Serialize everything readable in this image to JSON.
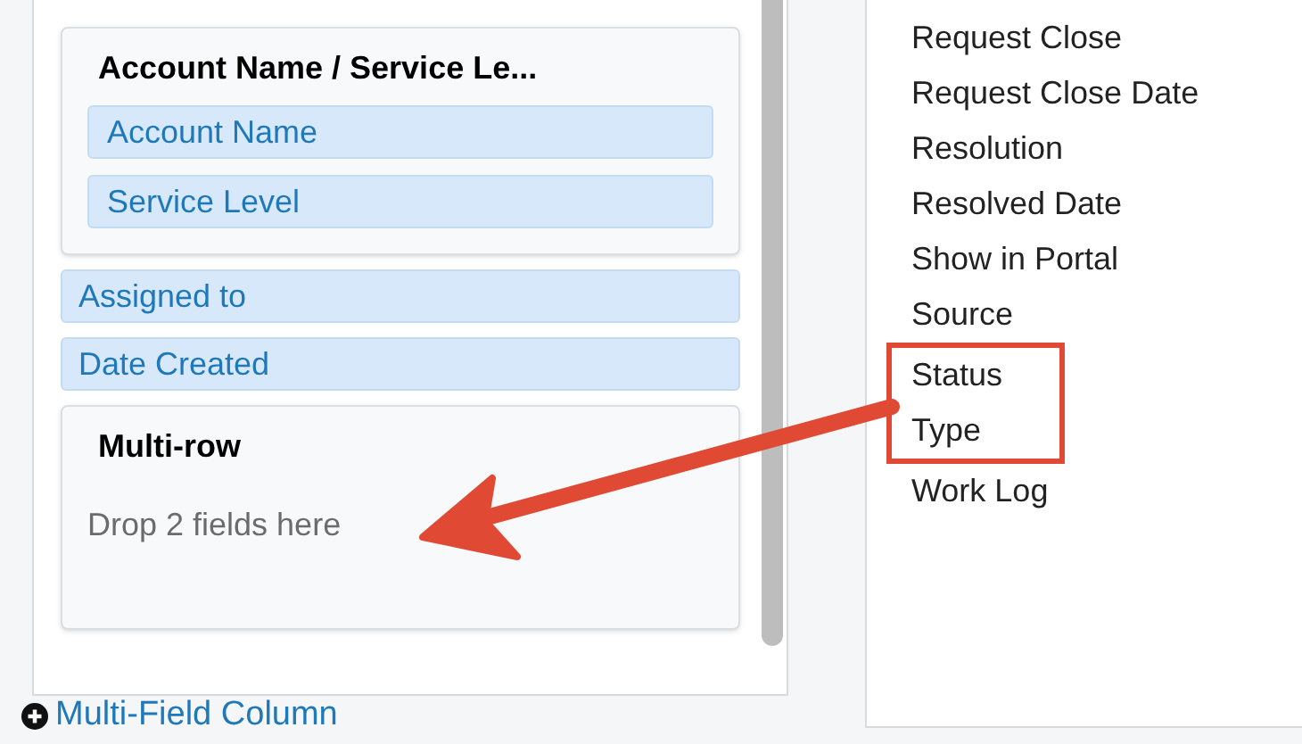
{
  "layout_panel": {
    "groups": [
      {
        "kind": "group",
        "title": "Account Name / Service Le...",
        "fields": [
          "Account Name",
          "Service Level"
        ]
      },
      {
        "kind": "field",
        "label": "Assigned to"
      },
      {
        "kind": "field",
        "label": "Date Created"
      },
      {
        "kind": "dropzone",
        "title": "Multi-row",
        "placeholder": "Drop 2 fields here"
      }
    ],
    "add_link": "Multi-Field Column"
  },
  "available_fields": [
    {
      "label": "Request Close",
      "highlighted": false
    },
    {
      "label": "Request Close Date",
      "highlighted": false
    },
    {
      "label": "Resolution",
      "highlighted": false
    },
    {
      "label": "Resolved Date",
      "highlighted": false
    },
    {
      "label": "Show in Portal",
      "highlighted": false
    },
    {
      "label": "Source",
      "highlighted": false
    },
    {
      "label": "Status",
      "highlighted": true
    },
    {
      "label": "Type",
      "highlighted": true
    },
    {
      "label": "Work Log",
      "highlighted": false
    }
  ]
}
